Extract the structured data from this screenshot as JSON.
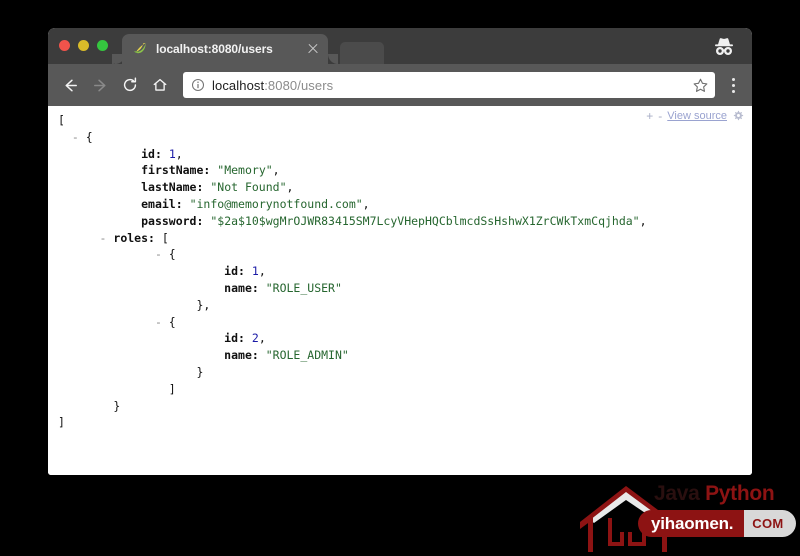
{
  "window": {
    "traffic_lights": [
      {
        "name": "close",
        "color": "#f1534b"
      },
      {
        "name": "minimize",
        "color": "#d9bb29"
      },
      {
        "name": "maximize",
        "color": "#35c63f"
      }
    ],
    "incognito_icon": "incognito-icon"
  },
  "tab": {
    "title": "localhost:8080/users",
    "favicon": "spring-leaf-favicon",
    "close_icon": "close-icon"
  },
  "toolbar": {
    "back_icon": "back-arrow-icon",
    "forward_icon": "forward-arrow-icon",
    "reload_icon": "reload-icon",
    "home_icon": "home-icon",
    "info_icon": "info-circle-icon",
    "star_icon": "star-icon",
    "menu_icon": "kebab-menu-icon",
    "url_host": "localhost",
    "url_path": ":8080/users"
  },
  "json_viewer": {
    "zoom_in": "+",
    "zoom_out": "-",
    "view_source_label": "View source",
    "settings_icon": "gear-icon",
    "lines": [
      {
        "indent": 0,
        "toggle": "",
        "content": [
          {
            "t": "punct",
            "v": "["
          }
        ]
      },
      {
        "indent": 1,
        "toggle": "-",
        "content": [
          {
            "t": "punct",
            "v": "{"
          }
        ]
      },
      {
        "indent": 3,
        "toggle": "",
        "content": [
          {
            "t": "key",
            "v": "id:"
          },
          {
            "t": "sp",
            "v": " "
          },
          {
            "t": "num",
            "v": "1"
          },
          {
            "t": "punct",
            "v": ","
          }
        ]
      },
      {
        "indent": 3,
        "toggle": "",
        "content": [
          {
            "t": "key",
            "v": "firstName:"
          },
          {
            "t": "sp",
            "v": " "
          },
          {
            "t": "str",
            "v": "\"Memory\""
          },
          {
            "t": "punct",
            "v": ","
          }
        ]
      },
      {
        "indent": 3,
        "toggle": "",
        "content": [
          {
            "t": "key",
            "v": "lastName:"
          },
          {
            "t": "sp",
            "v": " "
          },
          {
            "t": "str",
            "v": "\"Not Found\""
          },
          {
            "t": "punct",
            "v": ","
          }
        ]
      },
      {
        "indent": 3,
        "toggle": "",
        "content": [
          {
            "t": "key",
            "v": "email:"
          },
          {
            "t": "sp",
            "v": " "
          },
          {
            "t": "str",
            "v": "\"info@memorynotfound.com\""
          },
          {
            "t": "punct",
            "v": ","
          }
        ]
      },
      {
        "indent": 3,
        "toggle": "",
        "content": [
          {
            "t": "key",
            "v": "password:"
          },
          {
            "t": "sp",
            "v": " "
          },
          {
            "t": "str",
            "v": "\"$2a$10$wgMrOJWR83415SM7LcyVHepHQCblmcdSsHshwX1ZrCWkTxmCqjhda\""
          },
          {
            "t": "punct",
            "v": ","
          }
        ]
      },
      {
        "indent": 2,
        "toggle": "-",
        "content": [
          {
            "t": "key",
            "v": "roles:"
          },
          {
            "t": "sp",
            "v": " "
          },
          {
            "t": "punct",
            "v": "["
          }
        ]
      },
      {
        "indent": 4,
        "toggle": "-",
        "content": [
          {
            "t": "punct",
            "v": "{"
          }
        ]
      },
      {
        "indent": 6,
        "toggle": "",
        "content": [
          {
            "t": "key",
            "v": "id:"
          },
          {
            "t": "sp",
            "v": " "
          },
          {
            "t": "num",
            "v": "1"
          },
          {
            "t": "punct",
            "v": ","
          }
        ]
      },
      {
        "indent": 6,
        "toggle": "",
        "content": [
          {
            "t": "key",
            "v": "name:"
          },
          {
            "t": "sp",
            "v": " "
          },
          {
            "t": "str",
            "v": "\"ROLE_USER\""
          }
        ]
      },
      {
        "indent": 5,
        "toggle": "",
        "content": [
          {
            "t": "punct",
            "v": "},"
          }
        ]
      },
      {
        "indent": 4,
        "toggle": "-",
        "content": [
          {
            "t": "punct",
            "v": "{"
          }
        ]
      },
      {
        "indent": 6,
        "toggle": "",
        "content": [
          {
            "t": "key",
            "v": "id:"
          },
          {
            "t": "sp",
            "v": " "
          },
          {
            "t": "num",
            "v": "2"
          },
          {
            "t": "punct",
            "v": ","
          }
        ]
      },
      {
        "indent": 6,
        "toggle": "",
        "content": [
          {
            "t": "key",
            "v": "name:"
          },
          {
            "t": "sp",
            "v": " "
          },
          {
            "t": "str",
            "v": "\"ROLE_ADMIN\""
          }
        ]
      },
      {
        "indent": 5,
        "toggle": "",
        "content": [
          {
            "t": "punct",
            "v": "}"
          }
        ]
      },
      {
        "indent": 4,
        "toggle": "",
        "content": [
          {
            "t": "punct",
            "v": "]"
          }
        ]
      },
      {
        "indent": 2,
        "toggle": "",
        "content": [
          {
            "t": "punct",
            "v": "}"
          }
        ]
      },
      {
        "indent": 0,
        "toggle": "",
        "content": [
          {
            "t": "punct",
            "v": "]"
          }
        ]
      }
    ],
    "payload": [
      {
        "id": 1,
        "firstName": "Memory",
        "lastName": "Not Found",
        "email": "info@memorynotfound.com",
        "password": "$2a$10$wgMrOJWR83415SM7LcyVHepHQCblmcdSsHshwX1ZrCWkTxmCqjhda",
        "roles": [
          {
            "id": 1,
            "name": "ROLE_USER"
          },
          {
            "id": 2,
            "name": "ROLE_ADMIN"
          }
        ]
      }
    ]
  },
  "watermark": {
    "word_java": "Java",
    "word_python": "Python",
    "pill_left": "yihaomen.",
    "pill_right": "COM",
    "logo_icon": "house-logo-icon"
  }
}
